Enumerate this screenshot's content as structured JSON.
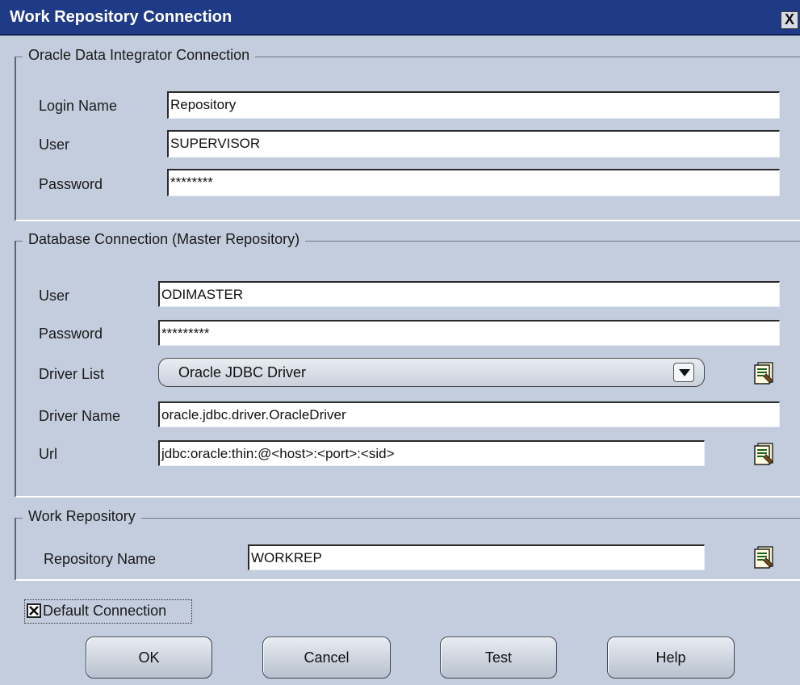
{
  "window": {
    "title": "Work Repository Connection",
    "close_label": "X"
  },
  "odi_connection": {
    "legend": "Oracle Data Integrator Connection",
    "login_name_label": "Login Name",
    "login_name_value": "Repository",
    "user_label": "User",
    "user_value": "SUPERVISOR",
    "password_label": "Password",
    "password_value": "********"
  },
  "db_connection": {
    "legend": "Database Connection (Master Repository)",
    "user_label": "User",
    "user_value": "ODIMASTER",
    "password_label": "Password",
    "password_value": "*********",
    "driver_list_label": "Driver List",
    "driver_list_value": "Oracle JDBC Driver",
    "driver_name_label": "Driver Name",
    "driver_name_value": "oracle.jdbc.driver.OracleDriver",
    "url_label": "Url",
    "url_value": "jdbc:oracle:thin:@<host>:<port>:<sid>"
  },
  "work_repository": {
    "legend": "Work Repository",
    "repository_name_label": "Repository Name",
    "repository_name_value": "WORKREP"
  },
  "default_connection": {
    "label": "Default Connection",
    "checked": true,
    "check_mark": "X"
  },
  "buttons": {
    "ok": "OK",
    "cancel": "Cancel",
    "test": "Test",
    "help": "Help"
  }
}
